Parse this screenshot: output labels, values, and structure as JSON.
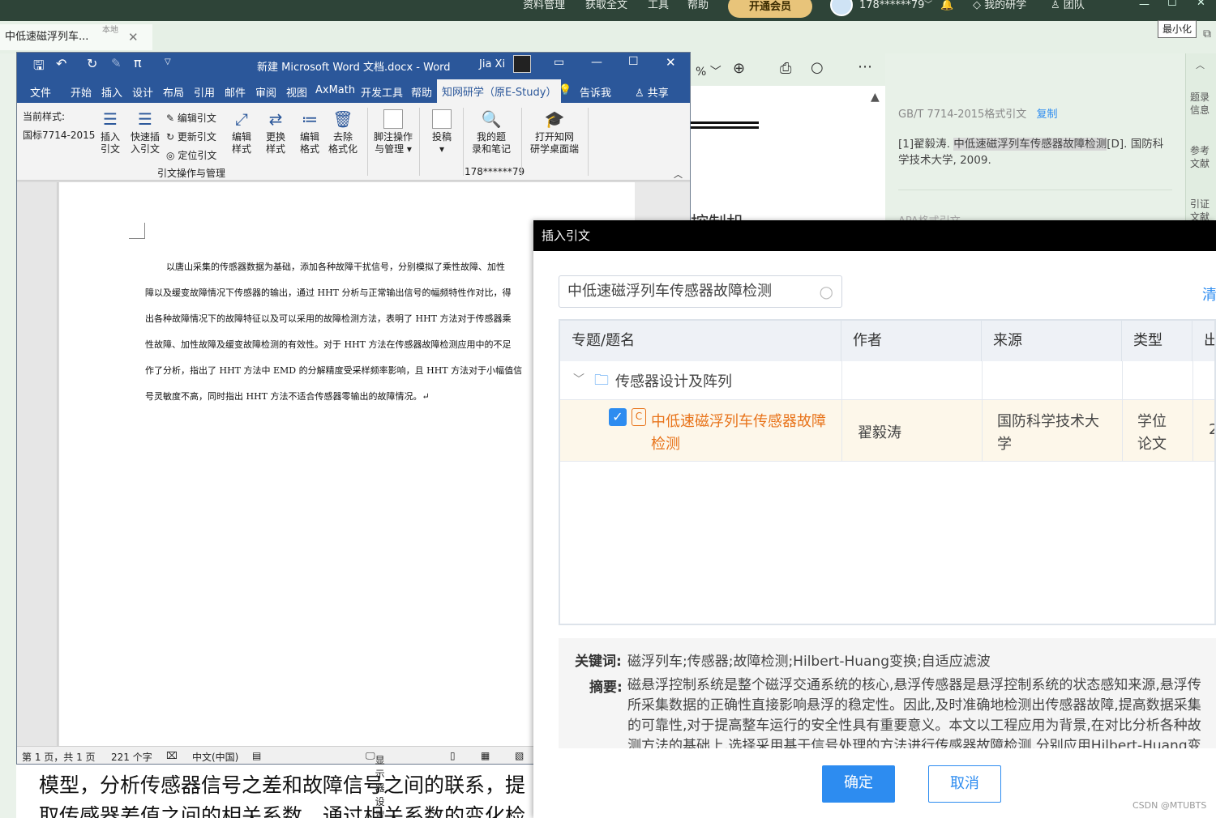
{
  "topbar": {
    "menu": [
      "资料管理",
      "获取全文",
      "工具",
      "帮助"
    ],
    "vip_label": "开通会员",
    "user": "178******79",
    "my_study": "我的研学",
    "team": "团队"
  },
  "tabs": {
    "doc_tab_title": "中低速磁浮列车...",
    "doc_tab_badge": "本地",
    "tooltip_minimize": "最小化"
  },
  "right_panel": {
    "gb_label": "GB/T 7714-2015格式引文",
    "copy": "复制",
    "citation_prefix": "[1]翟毅涛. ",
    "citation_highlight": "中低速磁浮列车传感器故障检测",
    "citation_suffix": "[D]. 国防科学技术大学, 2009.",
    "apa_label": "APA格式引文",
    "nav": [
      "题录信息",
      "参考文献",
      "引证文献"
    ]
  },
  "background_doc": {
    "partial_heading": "控制机"
  },
  "word": {
    "title": "新建 Microsoft Word 文档.docx  -  Word",
    "user": "Jia Xi",
    "menu": [
      "文件",
      "开始",
      "插入",
      "设计",
      "布局",
      "引用",
      "邮件",
      "审阅",
      "视图",
      "AxMath",
      "开发工具",
      "帮助",
      "知网研学（原E-Study）",
      "告诉我",
      "共享"
    ],
    "ribbon": {
      "current_style_label": "当前样式:",
      "current_style_value": "国标7714-2015",
      "insert_citation": [
        "插入",
        "引文"
      ],
      "quick_insert": [
        "快速插",
        "入引文"
      ],
      "edit_citation": "编辑引文",
      "update_citation": "更新引文",
      "locate_citation": "定位引文",
      "edit_style": [
        "编辑",
        "样式"
      ],
      "change_style": [
        "更换",
        "样式"
      ],
      "edit_format": [
        "编辑",
        "格式"
      ],
      "remove_format": [
        "去除",
        "格式化"
      ],
      "group_label": "引文操作与管理",
      "footnote": [
        "脚注操作",
        "与管理"
      ],
      "submit": "投稿",
      "my_notes": [
        "我的题",
        "录和笔记"
      ],
      "account": "178******79",
      "open_desktop": [
        "打开知网",
        "研学桌面端"
      ]
    },
    "body_lines": [
      "以唐山采集的传感器数据为基础，添加各种故障干扰信号，分别模拟了乘性故障、加性",
      "障以及缓变故障情况下传感器的输出，通过 HHT 分析与正常输出信号的幅频特性作对比，得",
      "出各种故障情况下的故障特征以及可以采用的故障检测方法，表明了 HHT 方法对于传感器乘",
      "性故障、加性故障及缓变故障检测的有效性。对于 HHT 方法在传感器故障检测应用中的不足",
      "作了分析，指出了 HHT 方法中 EMD 的分解精度受采样频率影响，且 HHT 方法对于小幅值信",
      "号灵敏度不高，同时指出 HHT 方法不适合传感器零输出的故障情况。↵"
    ],
    "status": {
      "page": "第 1 页，共 1 页",
      "words": "221 个字",
      "lang": "中文(中国)",
      "display": "显示器设置"
    }
  },
  "bottom_text": [
    "模型，分析传感器信号之差和故障信号之间的联系，提",
    "取传感器差值之间的相关系数，通过相关系数的变化检"
  ],
  "dialog": {
    "title": "插入引文",
    "search_value": "中低速磁浮列车传感器故障检测",
    "clear": "清",
    "columns": [
      "专题/题名",
      "作者",
      "来源",
      "类型",
      "出"
    ],
    "group": "传感器设计及阵列",
    "row": {
      "title_line1": "中低速磁浮列车传感器故障",
      "title_line2": "检测",
      "author": "翟毅涛",
      "source_line1": "国防科学技术大",
      "source_line2": "学",
      "type_line1": "学位",
      "type_line2": "论文",
      "year_partial": "2",
      "checked": true
    },
    "keywords_label": "关键词:",
    "keywords": "磁浮列车;传感器;故障检测;Hilbert-Huang变换;自适应滤波",
    "abstract_label": "摘要:",
    "abstract_lines": [
      "磁悬浮控制系统是整个磁浮交通系统的核心,悬浮传感器是悬浮控制系统的状态感知来源,悬浮传",
      "所采集数据的正确性直接影响悬浮的稳定性。因此,及时准确地检测出传感器故障,提高数据采集",
      "的可靠性,对于提高整车运行的安全性具有重要意义。本文以工程应用为背景,在对比分析各种故",
      "测方法的基础上,选择采用基于信号处理的方法进行传感器故障检测,分别应用Hilbert-Huang变"
    ],
    "ok": "确定",
    "cancel": "取消"
  },
  "watermark": "CSDN @MTUBTS",
  "colors": {
    "word_blue": "#2b579a",
    "orange": "#e8731a",
    "dialog_blue": "#2d8cf0",
    "app_green": "#2e4438"
  }
}
